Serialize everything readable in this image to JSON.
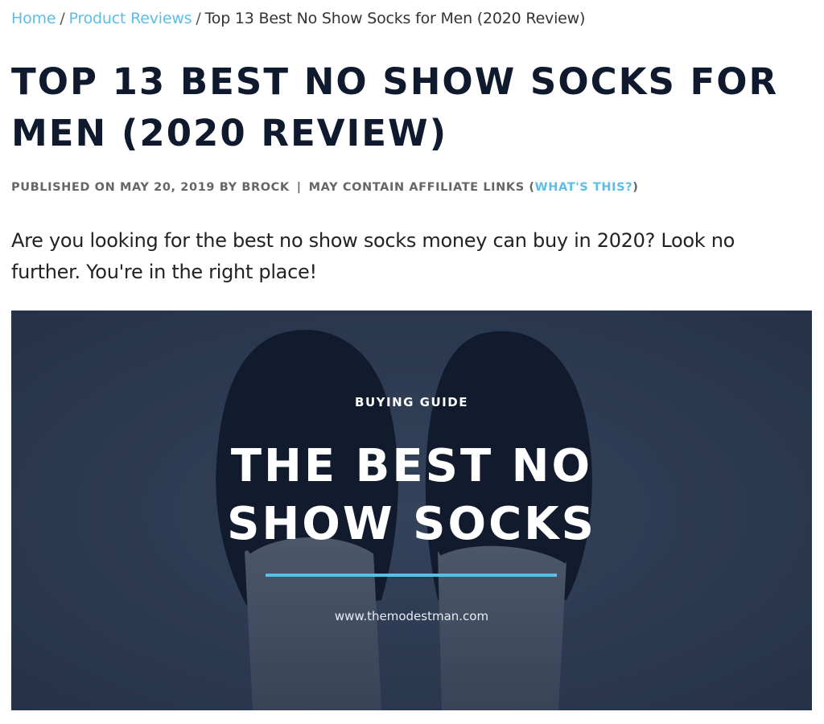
{
  "breadcrumb": {
    "home": "Home",
    "separator": "/",
    "category": "Product Reviews",
    "current": "Top 13 Best No Show Socks for Men (2020 Review)"
  },
  "article": {
    "title": "TOP 13 BEST NO SHOW SOCKS FOR MEN (2020 REVIEW)",
    "meta": {
      "published": "PUBLISHED ON MAY 20, 2019 BY BROCK",
      "pipe": "|",
      "affiliate": "MAY CONTAIN AFFILIATE LINKS (",
      "whats_this": "WHAT'S THIS?",
      "close_paren": ")"
    },
    "intro": "Are you looking for the best no show socks money can buy in 2020? Look no further. You're in the right place!"
  },
  "hero": {
    "kicker": "BUYING GUIDE",
    "title_line1": "THE BEST NO",
    "title_line2": "SHOW SOCKS",
    "site": "www.themodestman.com"
  },
  "colors": {
    "link": "#5bbde8",
    "title": "#0f1a2e",
    "hero_bg": "#2e3b50",
    "accent_rule": "#5bbde8"
  }
}
